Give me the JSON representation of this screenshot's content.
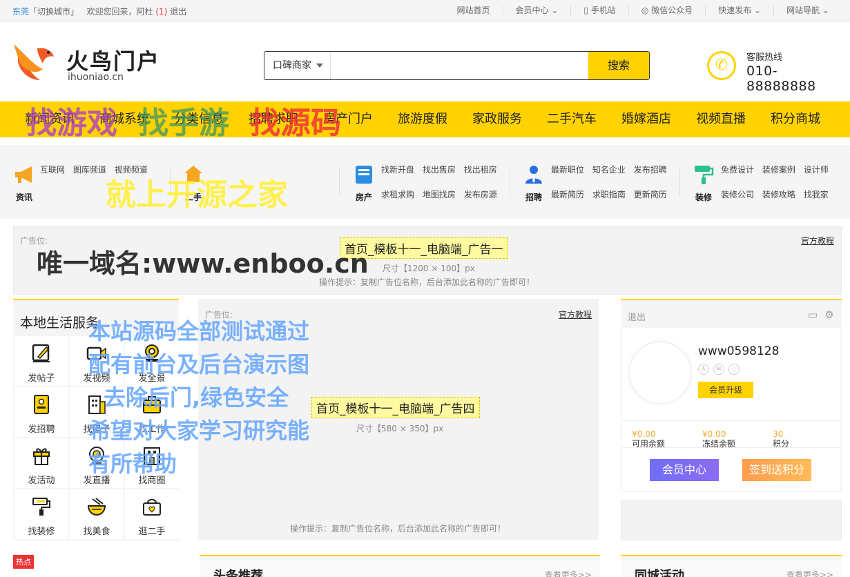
{
  "topbar": {
    "city": "东莞",
    "switch_city": "「切换城市」",
    "welcome": "欢迎您回来，阿杜",
    "msg_count": "(1)",
    "logout": "退出",
    "links": [
      "网站首页",
      "会员中心",
      "手机站",
      "微信公众号",
      "快速发布",
      "网站导航"
    ]
  },
  "header": {
    "logo_name": "火鸟门户",
    "logo_domain": "ihuoniao.cn",
    "search_category": "口碑商家",
    "search_placeholder": "",
    "search_button": "搜索",
    "hotline_label": "客服热线",
    "hotline_number": "010-88888888",
    "brand_color": "#ffd200"
  },
  "nav": {
    "items": [
      "新闻资讯",
      "商城系统",
      "分类信息",
      "招聘求职",
      "房产门户",
      "旅游度假",
      "家政服务",
      "二手汽车",
      "婚嫁酒店",
      "视频直播",
      "积分商城"
    ]
  },
  "cats": [
    {
      "label": "资讯",
      "icon": "megaphone-icon",
      "color": "#f5a623",
      "links": [
        "互联网",
        "图库频道",
        "视频频道"
      ]
    },
    {
      "label": "二手",
      "icon": "house-icon",
      "color": "#f5a623",
      "links": []
    },
    {
      "label": "房产",
      "icon": "building-icon",
      "color": "#2a8de0",
      "links": [
        "找新开盘",
        "找出售房",
        "找出租房",
        "求租求购",
        "地图找房",
        "发布房源"
      ]
    },
    {
      "label": "招聘",
      "icon": "person-icon",
      "color": "#2a6de0",
      "links": [
        "最新职位",
        "知名企业",
        "发布招聘",
        "最新简历",
        "求职指南",
        "更新简历"
      ]
    },
    {
      "label": "装修",
      "icon": "paint-roller-icon",
      "color": "#2cc08a",
      "links": [
        "免费设计",
        "装修案例",
        "设计师",
        "装修公司",
        "装修攻略",
        "找我家"
      ]
    }
  ],
  "ad_banner": {
    "tag": "广告位:",
    "title": "首页_模板十一_电脑端_广告一",
    "size": "尺寸【1200 × 100】px",
    "tip": "操作提示：复制广告位名称，后台添加此名称的广告即可！",
    "tutorial": "官方教程"
  },
  "services": {
    "title": "本地生活服务",
    "items": [
      {
        "label": "发帖子",
        "icon": "edit-icon"
      },
      {
        "label": "发视频",
        "icon": "video-icon"
      },
      {
        "label": "发全景",
        "icon": "panorama-icon"
      },
      {
        "label": "发招聘",
        "icon": "id-card-icon"
      },
      {
        "label": "找房子",
        "icon": "building-icon"
      },
      {
        "label": "找工作",
        "icon": "briefcase-icon"
      },
      {
        "label": "发活动",
        "icon": "gift-icon"
      },
      {
        "label": "发直播",
        "icon": "live-icon"
      },
      {
        "label": "找商圈",
        "icon": "shop-icon"
      },
      {
        "label": "找装修",
        "icon": "paint-roller-icon"
      },
      {
        "label": "找美食",
        "icon": "food-bowl-icon"
      },
      {
        "label": "逛二手",
        "icon": "basket-icon"
      }
    ]
  },
  "center_ad": {
    "tag": "广告位:",
    "title": "首页_模板十一_电脑端_广告四",
    "size": "尺寸【580 × 350】px",
    "tip": "操作提示：复制广告位名称，后台添加此名称的广告即可！",
    "tutorial": "官方教程"
  },
  "user": {
    "logout": "退出",
    "username": "www0598128",
    "upgrade": "会员升级",
    "balance_label": "可用余额",
    "balance": "¥0.00",
    "frozen_label": "冻结余额",
    "frozen": "¥0.00",
    "points_label": "积分",
    "points": "30",
    "member_center": "会员中心",
    "signin": "签到送积分"
  },
  "bottom": {
    "hot_badge": "热点",
    "headline_title": "头条推荐",
    "headline_more": "查看更多>>",
    "events_title": "同城活动",
    "events_more": "查看更多>>"
  },
  "watermarks": {
    "line1a": "找游戏",
    "line1b": "找手游",
    "line1c": "找源码",
    "line2": "就上开源之家",
    "line3": "唯一域名:www.enboo.cn",
    "block": [
      "本站源码全部测试通过",
      "配有前台及后台演示图",
      "去除后门,绿色安全",
      "希望对大家学习研究能",
      "有所帮助"
    ]
  }
}
